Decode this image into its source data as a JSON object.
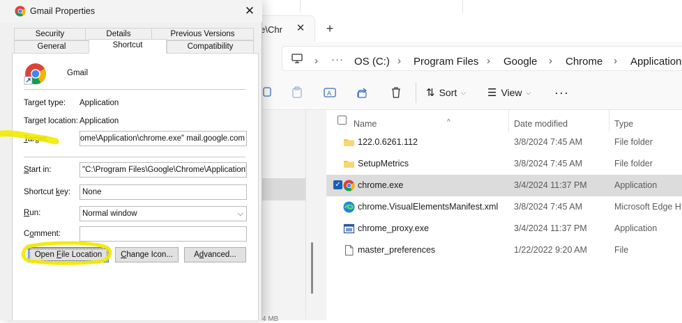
{
  "explorer": {
    "tab_label": "gle\\Chr",
    "breadcrumb": [
      "OS (C:)",
      "Program Files",
      "Google",
      "Chrome",
      "Application"
    ],
    "commands": {
      "sort": "Sort",
      "view": "View"
    },
    "columns": {
      "name": "Name",
      "date": "Date modified",
      "type": "Type"
    },
    "files": [
      {
        "name": "122.0.6261.112",
        "date": "3/8/2024 7:45 AM",
        "type": "File folder",
        "icon": "folder-icon"
      },
      {
        "name": "SetupMetrics",
        "date": "3/8/2024 7:45 AM",
        "type": "File folder",
        "icon": "folder-icon"
      },
      {
        "name": "chrome.exe",
        "date": "3/4/2024 11:37 PM",
        "type": "Application",
        "icon": "chrome-icon",
        "selected": true
      },
      {
        "name": "chrome.VisualElementsManifest.xml",
        "date": "3/8/2024 7:45 AM",
        "type": "Microsoft Edge H...",
        "icon": "edge-icon"
      },
      {
        "name": "chrome_proxy.exe",
        "date": "3/4/2024 11:37 PM",
        "type": "Application",
        "icon": "app-window-icon"
      },
      {
        "name": "master_preferences",
        "date": "1/22/2022 9:20 AM",
        "type": "File",
        "icon": "file-icon"
      }
    ],
    "status_snippet": "4 MB"
  },
  "dialog": {
    "title": "Gmail Properties",
    "tabs_row1": [
      "Security",
      "Details",
      "Previous Versions"
    ],
    "tabs_row2": [
      "General",
      "Shortcut",
      "Compatibility"
    ],
    "active_tab": "Shortcut",
    "shortcut_name": "Gmail",
    "target_type_label": "Target type:",
    "target_type": "Application",
    "target_location_label": "Target location:",
    "target_location": "Application",
    "target_label": "Target:",
    "target_value": "Chrome\\Application\\chrome.exe\" mail.google.com",
    "start_in_label": "Start in:",
    "start_in_value": "\"C:\\Program Files\\Google\\Chrome\\Application\"",
    "shortcut_key_label": "Shortcut key:",
    "shortcut_key_value": "None",
    "run_label": "Run:",
    "run_value": "Normal window",
    "comment_label": "Comment:",
    "comment_value": "",
    "buttons": {
      "open_file_location": "Open File Location",
      "change_icon": "Change Icon...",
      "advanced": "Advanced..."
    }
  },
  "colors": {
    "highlighter": "#f2ea00",
    "selection": "#dcdcdc",
    "accent": "#1a5fb4"
  }
}
